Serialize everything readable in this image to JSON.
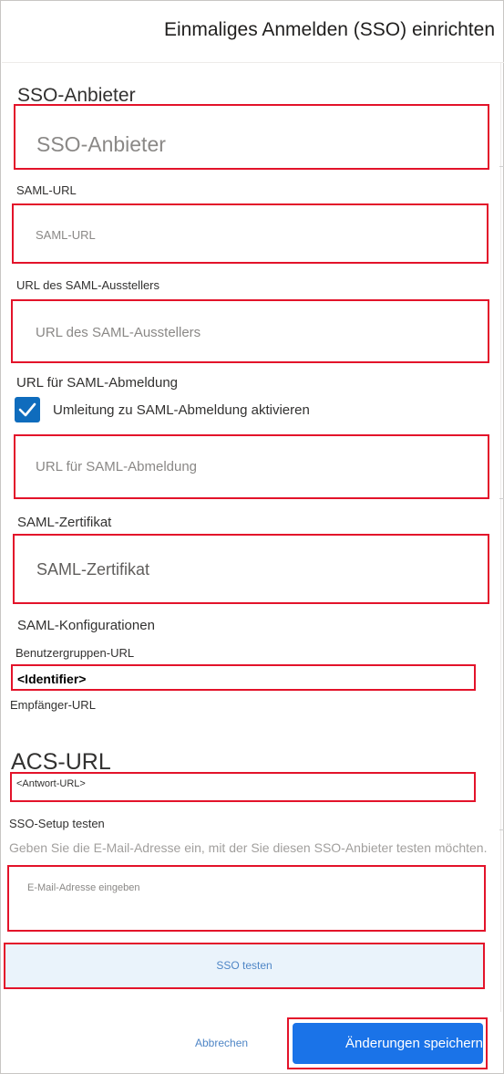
{
  "header": {
    "title": "Einmaliges Anmelden (SSO) einrichten"
  },
  "provider": {
    "label": "SSO-Anbieter",
    "placeholder": "SSO-Anbieter"
  },
  "saml_url": {
    "label": "SAML-URL",
    "placeholder": "SAML-URL"
  },
  "issuer_url": {
    "label": "URL des SAML-Ausstellers",
    "placeholder": "URL des SAML-Ausstellers"
  },
  "logout": {
    "label": "URL für SAML-Abmeldung",
    "checkbox_label": "Umleitung  zu  SAML-Abmeldung  aktivieren",
    "checkbox_checked": true,
    "placeholder": "URL  für  SAML-Abmeldung"
  },
  "certificate": {
    "label": "SAML-Zertifikat",
    "placeholder": "SAML-Zertifikat"
  },
  "configurations": {
    "heading": "SAML-Konfigurationen",
    "user_groups_url_label": "Benutzergruppen-URL",
    "identifier_value": "<Identifier>",
    "recipient_url_label": "Empfänger-URL",
    "acs_url_label": "ACS-URL",
    "reply_url_value": "<Antwort-URL>"
  },
  "test": {
    "heading": "SSO-Setup testen",
    "description": "Geben Sie die E-Mail-Adresse ein, mit der Sie diesen SSO-Anbieter testen möchten.",
    "email_placeholder": "E-Mail-Adresse eingeben",
    "button_label": "SSO testen"
  },
  "footer": {
    "cancel_label": "Abbrechen",
    "save_label": "Änderungen speichern"
  },
  "colors": {
    "highlight": "#e3132a",
    "primary": "#1a73e8",
    "checkbox": "#0f6cbd",
    "link": "#4f86c6"
  },
  "icons": {
    "checkbox": "checkmark-icon"
  }
}
